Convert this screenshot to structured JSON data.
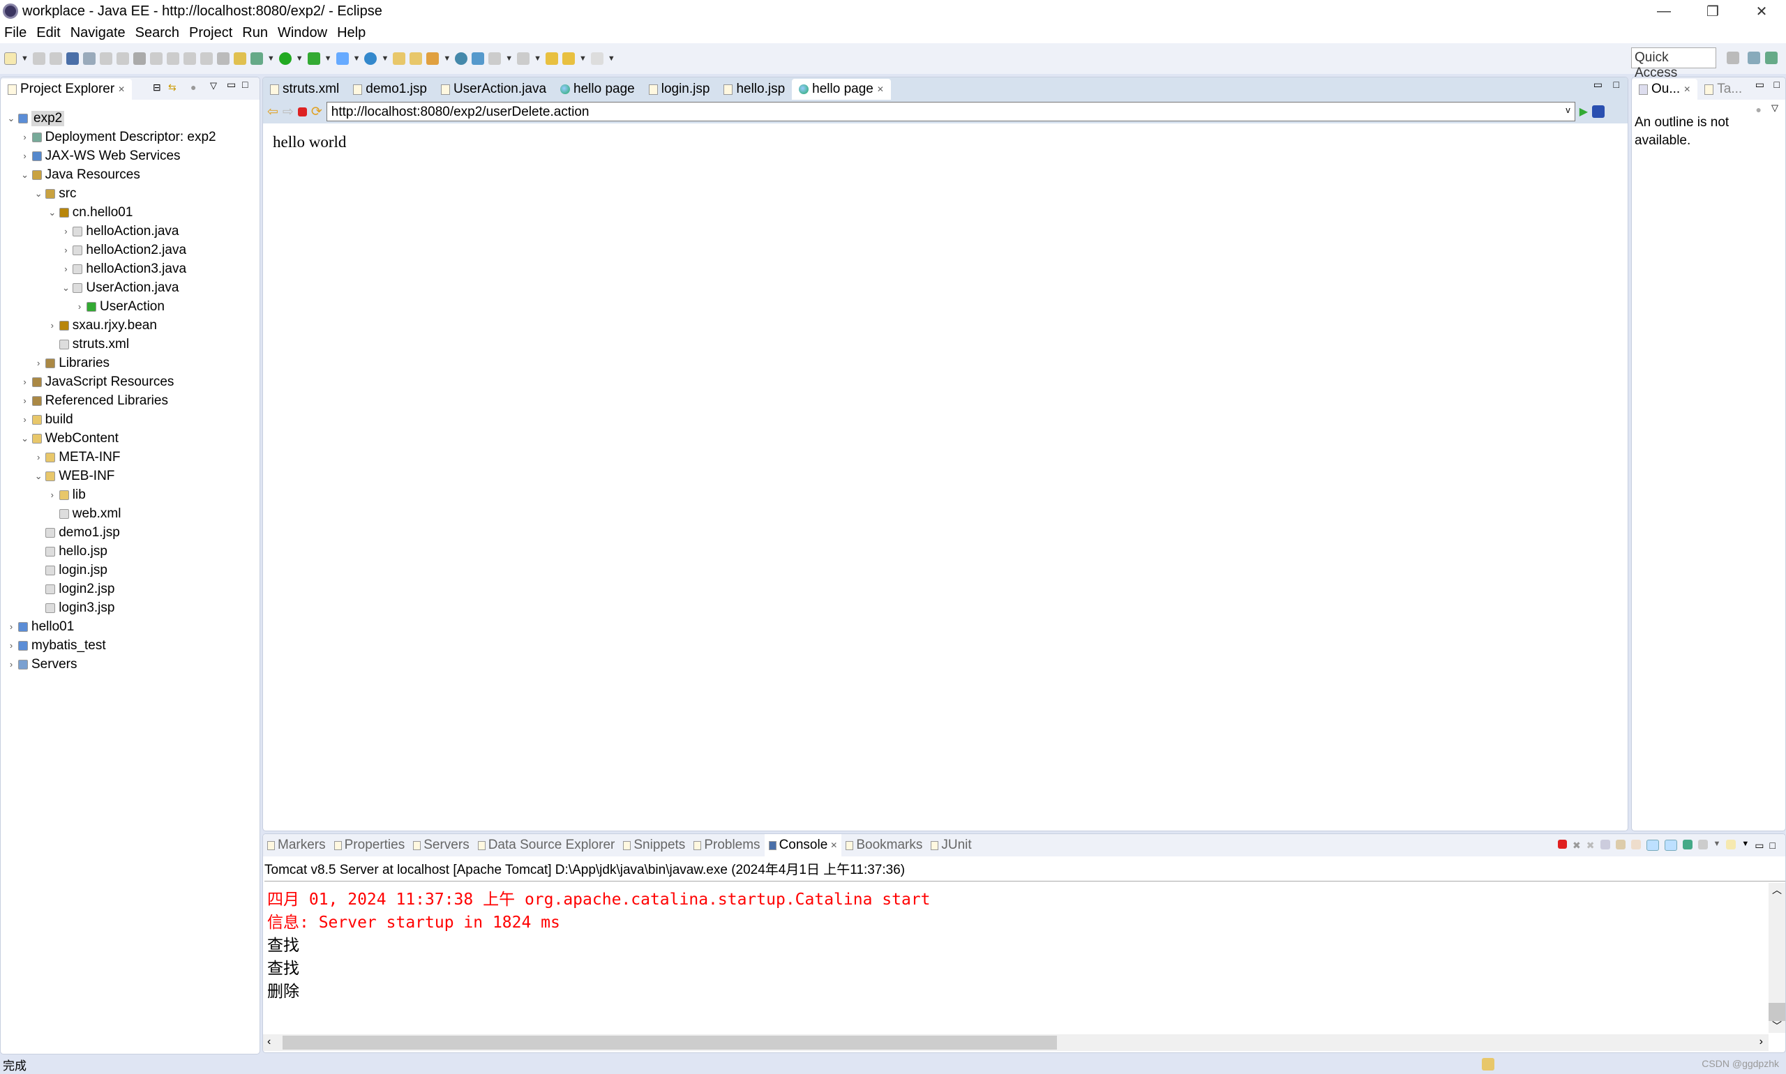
{
  "window": {
    "title": "workplace - Java EE - http://localhost:8080/exp2/ - Eclipse",
    "min": "—",
    "restore": "❐",
    "close": "✕"
  },
  "menu": [
    "File",
    "Edit",
    "Navigate",
    "Search",
    "Project",
    "Run",
    "Window",
    "Help"
  ],
  "quick_access": "Quick Access",
  "explorer": {
    "title": "Project Explorer",
    "tree": [
      {
        "label": "exp2",
        "level": 0,
        "state": "open",
        "icon": "project-icon",
        "color": "#5b8dd6",
        "selected": true
      },
      {
        "label": "Deployment Descriptor: exp2",
        "level": 1,
        "state": "closed",
        "icon": "descriptor-icon",
        "color": "#7a9"
      },
      {
        "label": "JAX-WS Web Services",
        "level": 1,
        "state": "closed",
        "icon": "webservice-icon",
        "color": "#58c"
      },
      {
        "label": "Java Resources",
        "level": 1,
        "state": "open",
        "icon": "java-resources-icon",
        "color": "#c9a240"
      },
      {
        "label": "src",
        "level": 2,
        "state": "open",
        "icon": "source-folder-icon",
        "color": "#c9a240"
      },
      {
        "label": "cn.hello01",
        "level": 3,
        "state": "open",
        "icon": "package-icon",
        "color": "#b8860b"
      },
      {
        "label": "helloAction.java",
        "level": 4,
        "state": "closed",
        "icon": "java-file-icon",
        "color": "#ddd"
      },
      {
        "label": "helloAction2.java",
        "level": 4,
        "state": "closed",
        "icon": "java-file-icon",
        "color": "#ddd"
      },
      {
        "label": "helloAction3.java",
        "level": 4,
        "state": "closed",
        "icon": "java-file-icon",
        "color": "#ddd"
      },
      {
        "label": "UserAction.java",
        "level": 4,
        "state": "open",
        "icon": "java-file-icon",
        "color": "#ddd"
      },
      {
        "label": "UserAction",
        "level": 5,
        "state": "closed",
        "icon": "class-icon",
        "color": "#3a3"
      },
      {
        "label": "sxau.rjxy.bean",
        "level": 3,
        "state": "closed",
        "icon": "package-icon",
        "color": "#b8860b"
      },
      {
        "label": "struts.xml",
        "level": 3,
        "state": "none",
        "icon": "xml-file-icon",
        "color": "#ddd"
      },
      {
        "label": "Libraries",
        "level": 2,
        "state": "closed",
        "icon": "library-icon",
        "color": "#a84"
      },
      {
        "label": "JavaScript Resources",
        "level": 1,
        "state": "closed",
        "icon": "js-resources-icon",
        "color": "#a84"
      },
      {
        "label": "Referenced Libraries",
        "level": 1,
        "state": "closed",
        "icon": "library-icon",
        "color": "#a84"
      },
      {
        "label": "build",
        "level": 1,
        "state": "closed",
        "icon": "folder-icon",
        "color": "#e8c76a"
      },
      {
        "label": "WebContent",
        "level": 1,
        "state": "open",
        "icon": "folder-icon",
        "color": "#e8c76a"
      },
      {
        "label": "META-INF",
        "level": 2,
        "state": "closed",
        "icon": "folder-icon",
        "color": "#e8c76a"
      },
      {
        "label": "WEB-INF",
        "level": 2,
        "state": "open",
        "icon": "folder-icon",
        "color": "#e8c76a"
      },
      {
        "label": "lib",
        "level": 3,
        "state": "closed",
        "icon": "folder-icon",
        "color": "#e8c76a"
      },
      {
        "label": "web.xml",
        "level": 3,
        "state": "none",
        "icon": "xml-file-icon",
        "color": "#ddd"
      },
      {
        "label": "demo1.jsp",
        "level": 2,
        "state": "none",
        "icon": "jsp-file-icon",
        "color": "#ddd"
      },
      {
        "label": "hello.jsp",
        "level": 2,
        "state": "none",
        "icon": "jsp-file-icon",
        "color": "#ddd"
      },
      {
        "label": "login.jsp",
        "level": 2,
        "state": "none",
        "icon": "jsp-file-icon",
        "color": "#ddd"
      },
      {
        "label": "login2.jsp",
        "level": 2,
        "state": "none",
        "icon": "jsp-file-icon",
        "color": "#ddd"
      },
      {
        "label": "login3.jsp",
        "level": 2,
        "state": "none",
        "icon": "jsp-file-icon",
        "color": "#ddd"
      },
      {
        "label": "hello01",
        "level": 0,
        "state": "closed",
        "icon": "project-icon",
        "color": "#5b8dd6"
      },
      {
        "label": "mybatis_test",
        "level": 0,
        "state": "closed",
        "icon": "project-icon",
        "color": "#5b8dd6"
      },
      {
        "label": "Servers",
        "level": 0,
        "state": "closed",
        "icon": "folder-icon",
        "color": "#7aa0d0"
      }
    ]
  },
  "editor": {
    "tabs": [
      {
        "label": "struts.xml",
        "icon": "xml-file-icon"
      },
      {
        "label": "demo1.jsp",
        "icon": "jsp-file-icon"
      },
      {
        "label": "UserAction.java",
        "icon": "java-file-icon"
      },
      {
        "label": "hello page",
        "icon": "globe-icon"
      },
      {
        "label": "login.jsp",
        "icon": "jsp-file-icon"
      },
      {
        "label": "hello.jsp",
        "icon": "jsp-file-icon"
      },
      {
        "label": "hello page",
        "icon": "globe-icon",
        "active": true
      }
    ],
    "url": "http://localhost:8080/exp2/userDelete.action",
    "content": "hello world"
  },
  "outline": {
    "tabs": [
      "Ou...",
      "Ta..."
    ],
    "message": "An outline is not available."
  },
  "bottom": {
    "tabs": [
      "Markers",
      "Properties",
      "Servers",
      "Data Source Explorer",
      "Snippets",
      "Problems",
      "Console",
      "Bookmarks",
      "JUnit"
    ],
    "active_tab": "Console",
    "process": "Tomcat v8.5 Server at localhost [Apache Tomcat] D:\\App\\jdk\\java\\bin\\javaw.exe (2024年4月1日 上午11:37:36)",
    "lines": [
      {
        "text": "四月 01, 2024 11:37:38 上午 org.apache.catalina.startup.Catalina start",
        "color": "#ff0000"
      },
      {
        "text": "信息: Server startup in 1824 ms",
        "color": "#ff0000"
      },
      {
        "text": "查找",
        "color": "#000000"
      },
      {
        "text": "查找",
        "color": "#000000"
      },
      {
        "text": "删除",
        "color": "#000000"
      }
    ]
  },
  "status": {
    "text": "完成",
    "watermark": "CSDN @ggdpzhk"
  }
}
